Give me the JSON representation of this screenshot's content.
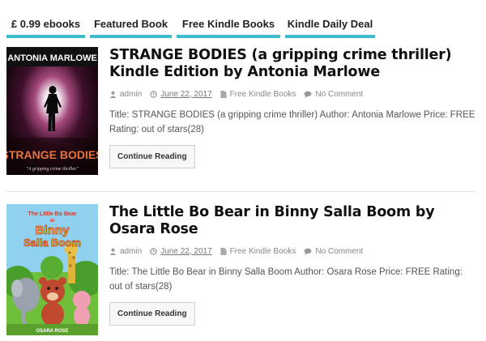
{
  "tabs": [
    {
      "label": "£ 0.99 ebooks"
    },
    {
      "label": "Featured Book"
    },
    {
      "label": "Free Kindle Books"
    },
    {
      "label": "Kindle Daily Deal"
    }
  ],
  "posts": [
    {
      "title": "STRANGE BODIES (a gripping crime thriller) Kindle Edition by Antonia Marlowe",
      "author": "admin",
      "date": "June 22, 2017",
      "category": "Free Kindle Books",
      "comments": "No Comment",
      "excerpt": "Title: STRANGE BODIES (a gripping crime thriller) Author: Antonia Marlowe Price: FREE Rating: out of stars(28)",
      "button": "Continue Reading",
      "cover": {
        "author": "ANTONIA MARLOWE",
        "title": "STRANGE BODIES",
        "tagline": "\"A gripping crime thriller\""
      }
    },
    {
      "title": "The Little Bo Bear in Binny Salla Boom by Osara Rose",
      "author": "admin",
      "date": "June 22, 2017",
      "category": "Free Kindle Books",
      "comments": "No Comment",
      "excerpt": "Title: The Little Bo Bear in Binny Salla Boom Author: Osara Rose Price: FREE Rating: out of stars(28)",
      "button": "Continue Reading",
      "cover": {
        "title_top": "The Little Bo Bear",
        "title_in": "in",
        "title_big1": "Binny",
        "title_big2": "Salla Boom",
        "author": "OSARA ROSE"
      }
    }
  ]
}
